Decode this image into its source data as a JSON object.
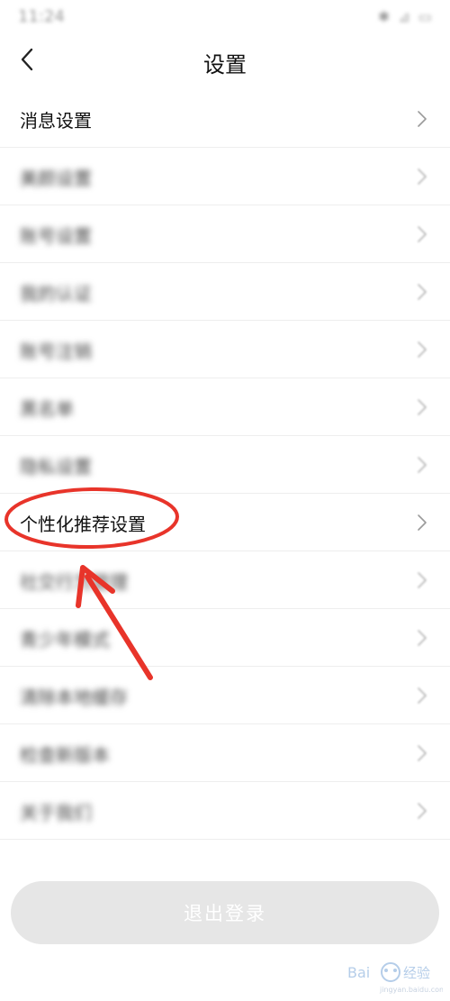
{
  "status_bar": {
    "time": "11:24",
    "icons": "✱ ⊿ ▭"
  },
  "header": {
    "title": "设置",
    "back_icon": "chevron-left-icon"
  },
  "settings_list": {
    "items": [
      {
        "label": "消息设置",
        "blurred": false
      },
      {
        "label": "美颜设置",
        "blurred": true
      },
      {
        "label": "账号设置",
        "blurred": true
      },
      {
        "label": "我的认证",
        "blurred": true
      },
      {
        "label": "账号注销",
        "blurred": true
      },
      {
        "label": "黑名单",
        "blurred": true
      },
      {
        "label": "隐私设置",
        "blurred": true
      },
      {
        "label": "个性化推荐设置",
        "blurred": false
      },
      {
        "label": "社交行为管理",
        "blurred": true
      },
      {
        "label": "青少年模式",
        "blurred": true
      },
      {
        "label": "清除本地缓存",
        "blurred": true
      },
      {
        "label": "检查新版本",
        "blurred": true
      },
      {
        "label": "关于我们",
        "blurred": true
      }
    ]
  },
  "logout": {
    "label": "退出登录"
  },
  "annotation": {
    "color": "#e8342a",
    "highlight_target": "个性化推荐设置"
  },
  "watermark": {
    "text": "Bai经验",
    "subtext": "jingyan.baidu.com"
  },
  "colors": {
    "text": "#111111",
    "chevron": "#9a9a9a",
    "divider": "#eeeeee",
    "logout_bg": "#e6e6e6"
  }
}
